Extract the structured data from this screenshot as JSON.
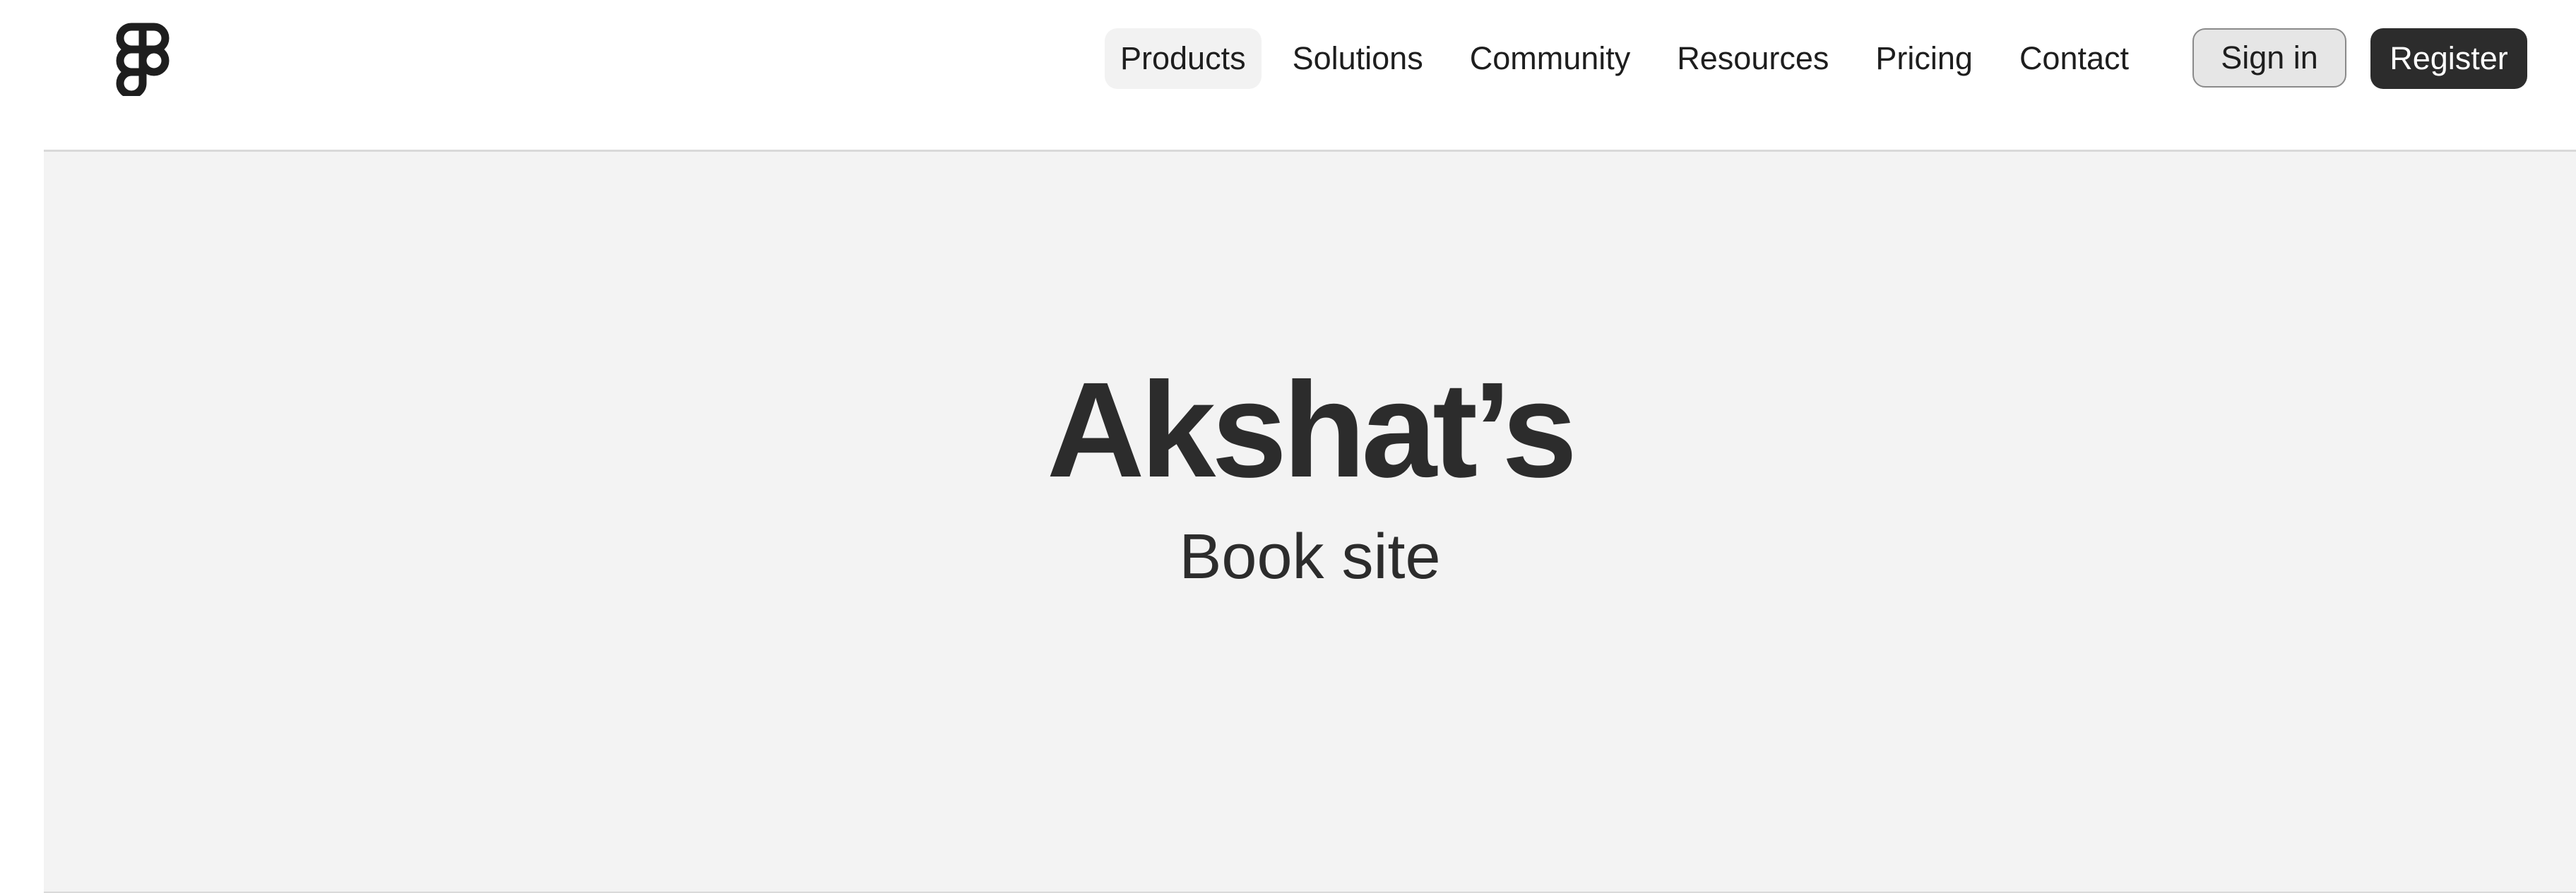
{
  "header": {
    "logo_icon": "figma-logo-icon",
    "nav": [
      {
        "label": "Products",
        "active": true
      },
      {
        "label": "Solutions",
        "active": false
      },
      {
        "label": "Community",
        "active": false
      },
      {
        "label": "Resources",
        "active": false
      },
      {
        "label": "Pricing",
        "active": false
      },
      {
        "label": "Contact",
        "active": false
      }
    ],
    "sign_in_label": "Sign in",
    "register_label": "Register"
  },
  "hero": {
    "title": "Akshat’s",
    "subtitle": "Book site"
  },
  "colors": {
    "text": "#1e1e1e",
    "hero_text": "#2c2c2c",
    "hero_background": "#f3f3f3",
    "active_nav_background": "#f2f2f2",
    "register_background": "#2c2c2c",
    "sign_in_background": "#e6e6e6"
  }
}
